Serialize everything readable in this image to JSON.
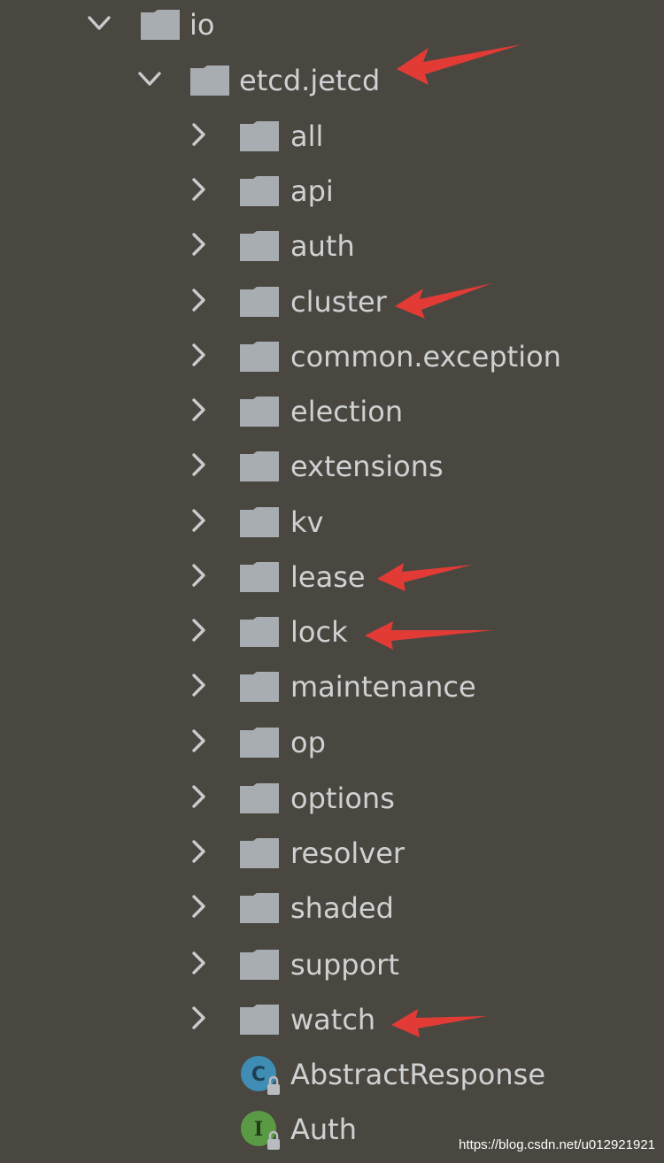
{
  "tree": {
    "root": {
      "label": "io",
      "icon": "folder-icon",
      "expanded": true
    },
    "package": {
      "label": "etcd.jetcd",
      "icon": "folder-icon",
      "expanded": true
    },
    "folders": [
      {
        "label": "all"
      },
      {
        "label": "api"
      },
      {
        "label": "auth"
      },
      {
        "label": "cluster"
      },
      {
        "label": "common.exception"
      },
      {
        "label": "election"
      },
      {
        "label": "extensions"
      },
      {
        "label": "kv"
      },
      {
        "label": "lease"
      },
      {
        "label": "lock"
      },
      {
        "label": "maintenance"
      },
      {
        "label": "op"
      },
      {
        "label": "options"
      },
      {
        "label": "resolver"
      },
      {
        "label": "shaded"
      },
      {
        "label": "support"
      },
      {
        "label": "watch"
      }
    ],
    "classes": [
      {
        "label": "AbstractResponse",
        "icon": "class-icon",
        "badge": "C",
        "color": "#3f8db5"
      },
      {
        "label": "Auth",
        "icon": "interface-icon",
        "badge": "I",
        "color": "#5b9a45"
      }
    ]
  },
  "annotations": {
    "arrow_color": "#e23b36",
    "highlighted": [
      "etcd.jetcd",
      "cluster",
      "lease",
      "lock",
      "watch"
    ]
  },
  "colors": {
    "background": "#4a4740",
    "text": "#cfd1d3",
    "folder": "#a8adb2",
    "chevron": "#c9cbcd"
  },
  "watermark": "https://blog.csdn.net/u012921921"
}
